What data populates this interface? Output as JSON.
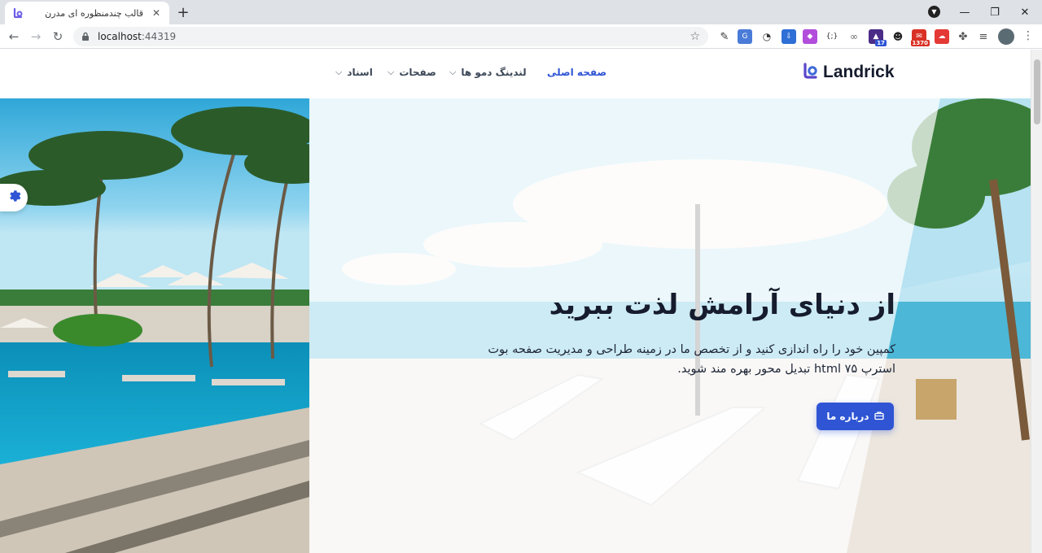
{
  "browser": {
    "tab_title": "قالب چندمنظوره ای مدرن",
    "url_host": "localhost",
    "url_port": ":44319",
    "new_tab": "+",
    "extension_badges": {
      "ext_17": "17",
      "ext_1370": "1370"
    }
  },
  "site": {
    "logo_text": "Landrick",
    "nav": {
      "home": "صفحه اصلی",
      "landings": "لندینگ دمو ها",
      "pages": "صفحات",
      "docs": "اسناد"
    }
  },
  "hero": {
    "title": "از دنیای آرامش لذت ببرید",
    "description": "کمپین خود را راه اندازی کنید و از تخصص ما در زمینه طراحی و مدیریت صفحه بوت استرپ html ۷۵ تبدیل محور بهره مند شوید.",
    "button_label": "درباره ما"
  },
  "colors": {
    "primary": "#2f55d4",
    "text_dark": "#161c2d",
    "nav_text": "#3c4858"
  },
  "icons": {
    "settings": "gear-icon",
    "button": "briefcase-icon",
    "logo": "landrick-logo-icon"
  }
}
